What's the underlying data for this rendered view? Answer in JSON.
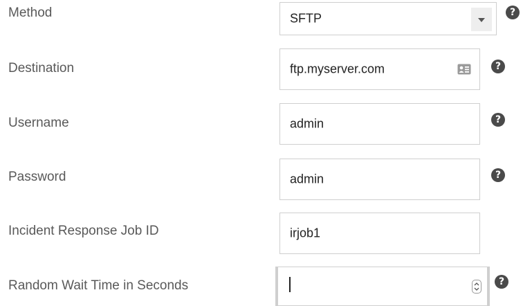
{
  "form": {
    "method": {
      "label": "Method",
      "value": "SFTP",
      "help_icon": "question-circle-icon"
    },
    "destination": {
      "label": "Destination",
      "value": "ftp.myserver.com",
      "field_icon": "contact-card-icon",
      "help_icon": "question-circle-icon"
    },
    "username": {
      "label": "Username",
      "value": "admin",
      "help_icon": "question-circle-icon"
    },
    "password": {
      "label": "Password",
      "value": "admin",
      "help_icon": "question-circle-icon"
    },
    "incident_job_id": {
      "label": "Incident Response Job ID",
      "value": "irjob1"
    },
    "random_wait": {
      "label": "Random Wait Time in Seconds",
      "value": "",
      "field_icon": "spinner-icon",
      "help_icon": "question-circle-icon"
    }
  },
  "help_glyph": "?"
}
